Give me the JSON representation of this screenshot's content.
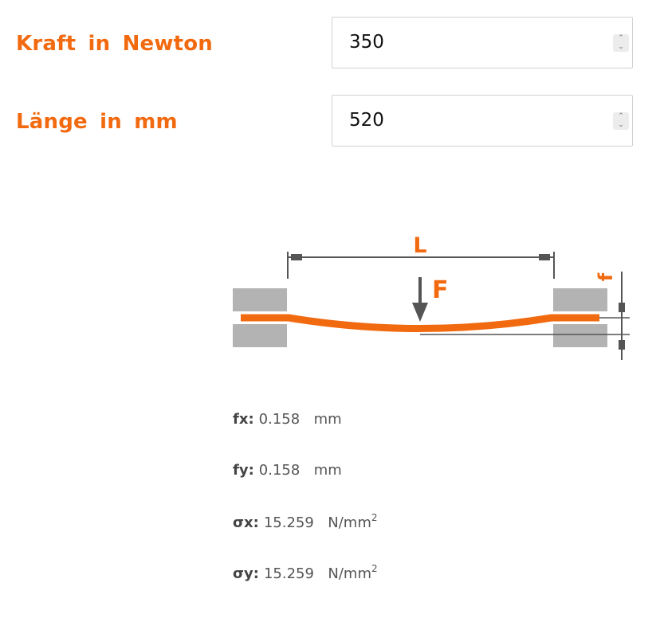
{
  "form": {
    "force": {
      "label": "Kraft in Newton",
      "value": "350"
    },
    "length": {
      "label": "Länge in mm",
      "value": "520"
    }
  },
  "diagram": {
    "length_label": "L",
    "force_label": "F",
    "deflection_label": "f"
  },
  "results": [
    {
      "key": "fx:",
      "value": "0.158",
      "unit": "mm",
      "sup": ""
    },
    {
      "key": "fy:",
      "value": "0.158",
      "unit": "mm",
      "sup": ""
    },
    {
      "key": "σx:",
      "value": "15.259",
      "unit": "N/mm",
      "sup": "2"
    },
    {
      "key": "σy:",
      "value": "15.259",
      "unit": "N/mm",
      "sup": "2"
    }
  ],
  "colors": {
    "accent": "#f26a10",
    "clamp": "#b3b3b3",
    "dim": "#555555"
  }
}
